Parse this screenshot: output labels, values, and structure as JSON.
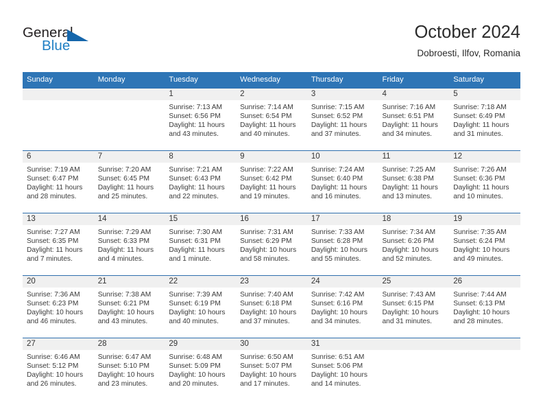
{
  "brand": {
    "name_part1": "General",
    "name_part2": "Blue",
    "logo_icon": "blue-triangle-icon"
  },
  "header": {
    "title": "October 2024",
    "subtitle": "Dobroesti, Ilfov, Romania"
  },
  "colors": {
    "header_blue": "#2e75b6",
    "separator_blue": "#2e6fae",
    "daynum_strip_gray": "#f0f0f0",
    "brand_blue": "#1f7fc4",
    "brand_dark": "#231f20",
    "text": "#333333"
  },
  "weekdays": [
    "Sunday",
    "Monday",
    "Tuesday",
    "Wednesday",
    "Thursday",
    "Friday",
    "Saturday"
  ],
  "labels": {
    "sunrise_prefix": "Sunrise: ",
    "sunset_prefix": "Sunset: ",
    "daylight_prefix": "Daylight: "
  },
  "weeks": [
    [
      {
        "day": "",
        "blank": true
      },
      {
        "day": "",
        "blank": true
      },
      {
        "day": "1",
        "sunrise": "Sunrise: 7:13 AM",
        "sunset": "Sunset: 6:56 PM",
        "daylight_1": "Daylight: 11 hours",
        "daylight_2": "and 43 minutes."
      },
      {
        "day": "2",
        "sunrise": "Sunrise: 7:14 AM",
        "sunset": "Sunset: 6:54 PM",
        "daylight_1": "Daylight: 11 hours",
        "daylight_2": "and 40 minutes."
      },
      {
        "day": "3",
        "sunrise": "Sunrise: 7:15 AM",
        "sunset": "Sunset: 6:52 PM",
        "daylight_1": "Daylight: 11 hours",
        "daylight_2": "and 37 minutes."
      },
      {
        "day": "4",
        "sunrise": "Sunrise: 7:16 AM",
        "sunset": "Sunset: 6:51 PM",
        "daylight_1": "Daylight: 11 hours",
        "daylight_2": "and 34 minutes."
      },
      {
        "day": "5",
        "sunrise": "Sunrise: 7:18 AM",
        "sunset": "Sunset: 6:49 PM",
        "daylight_1": "Daylight: 11 hours",
        "daylight_2": "and 31 minutes."
      }
    ],
    [
      {
        "day": "6",
        "sunrise": "Sunrise: 7:19 AM",
        "sunset": "Sunset: 6:47 PM",
        "daylight_1": "Daylight: 11 hours",
        "daylight_2": "and 28 minutes."
      },
      {
        "day": "7",
        "sunrise": "Sunrise: 7:20 AM",
        "sunset": "Sunset: 6:45 PM",
        "daylight_1": "Daylight: 11 hours",
        "daylight_2": "and 25 minutes."
      },
      {
        "day": "8",
        "sunrise": "Sunrise: 7:21 AM",
        "sunset": "Sunset: 6:43 PM",
        "daylight_1": "Daylight: 11 hours",
        "daylight_2": "and 22 minutes."
      },
      {
        "day": "9",
        "sunrise": "Sunrise: 7:22 AM",
        "sunset": "Sunset: 6:42 PM",
        "daylight_1": "Daylight: 11 hours",
        "daylight_2": "and 19 minutes."
      },
      {
        "day": "10",
        "sunrise": "Sunrise: 7:24 AM",
        "sunset": "Sunset: 6:40 PM",
        "daylight_1": "Daylight: 11 hours",
        "daylight_2": "and 16 minutes."
      },
      {
        "day": "11",
        "sunrise": "Sunrise: 7:25 AM",
        "sunset": "Sunset: 6:38 PM",
        "daylight_1": "Daylight: 11 hours",
        "daylight_2": "and 13 minutes."
      },
      {
        "day": "12",
        "sunrise": "Sunrise: 7:26 AM",
        "sunset": "Sunset: 6:36 PM",
        "daylight_1": "Daylight: 11 hours",
        "daylight_2": "and 10 minutes."
      }
    ],
    [
      {
        "day": "13",
        "sunrise": "Sunrise: 7:27 AM",
        "sunset": "Sunset: 6:35 PM",
        "daylight_1": "Daylight: 11 hours",
        "daylight_2": "and 7 minutes."
      },
      {
        "day": "14",
        "sunrise": "Sunrise: 7:29 AM",
        "sunset": "Sunset: 6:33 PM",
        "daylight_1": "Daylight: 11 hours",
        "daylight_2": "and 4 minutes."
      },
      {
        "day": "15",
        "sunrise": "Sunrise: 7:30 AM",
        "sunset": "Sunset: 6:31 PM",
        "daylight_1": "Daylight: 11 hours",
        "daylight_2": "and 1 minute."
      },
      {
        "day": "16",
        "sunrise": "Sunrise: 7:31 AM",
        "sunset": "Sunset: 6:29 PM",
        "daylight_1": "Daylight: 10 hours",
        "daylight_2": "and 58 minutes."
      },
      {
        "day": "17",
        "sunrise": "Sunrise: 7:33 AM",
        "sunset": "Sunset: 6:28 PM",
        "daylight_1": "Daylight: 10 hours",
        "daylight_2": "and 55 minutes."
      },
      {
        "day": "18",
        "sunrise": "Sunrise: 7:34 AM",
        "sunset": "Sunset: 6:26 PM",
        "daylight_1": "Daylight: 10 hours",
        "daylight_2": "and 52 minutes."
      },
      {
        "day": "19",
        "sunrise": "Sunrise: 7:35 AM",
        "sunset": "Sunset: 6:24 PM",
        "daylight_1": "Daylight: 10 hours",
        "daylight_2": "and 49 minutes."
      }
    ],
    [
      {
        "day": "20",
        "sunrise": "Sunrise: 7:36 AM",
        "sunset": "Sunset: 6:23 PM",
        "daylight_1": "Daylight: 10 hours",
        "daylight_2": "and 46 minutes."
      },
      {
        "day": "21",
        "sunrise": "Sunrise: 7:38 AM",
        "sunset": "Sunset: 6:21 PM",
        "daylight_1": "Daylight: 10 hours",
        "daylight_2": "and 43 minutes."
      },
      {
        "day": "22",
        "sunrise": "Sunrise: 7:39 AM",
        "sunset": "Sunset: 6:19 PM",
        "daylight_1": "Daylight: 10 hours",
        "daylight_2": "and 40 minutes."
      },
      {
        "day": "23",
        "sunrise": "Sunrise: 7:40 AM",
        "sunset": "Sunset: 6:18 PM",
        "daylight_1": "Daylight: 10 hours",
        "daylight_2": "and 37 minutes."
      },
      {
        "day": "24",
        "sunrise": "Sunrise: 7:42 AM",
        "sunset": "Sunset: 6:16 PM",
        "daylight_1": "Daylight: 10 hours",
        "daylight_2": "and 34 minutes."
      },
      {
        "day": "25",
        "sunrise": "Sunrise: 7:43 AM",
        "sunset": "Sunset: 6:15 PM",
        "daylight_1": "Daylight: 10 hours",
        "daylight_2": "and 31 minutes."
      },
      {
        "day": "26",
        "sunrise": "Sunrise: 7:44 AM",
        "sunset": "Sunset: 6:13 PM",
        "daylight_1": "Daylight: 10 hours",
        "daylight_2": "and 28 minutes."
      }
    ],
    [
      {
        "day": "27",
        "sunrise": "Sunrise: 6:46 AM",
        "sunset": "Sunset: 5:12 PM",
        "daylight_1": "Daylight: 10 hours",
        "daylight_2": "and 26 minutes."
      },
      {
        "day": "28",
        "sunrise": "Sunrise: 6:47 AM",
        "sunset": "Sunset: 5:10 PM",
        "daylight_1": "Daylight: 10 hours",
        "daylight_2": "and 23 minutes."
      },
      {
        "day": "29",
        "sunrise": "Sunrise: 6:48 AM",
        "sunset": "Sunset: 5:09 PM",
        "daylight_1": "Daylight: 10 hours",
        "daylight_2": "and 20 minutes."
      },
      {
        "day": "30",
        "sunrise": "Sunrise: 6:50 AM",
        "sunset": "Sunset: 5:07 PM",
        "daylight_1": "Daylight: 10 hours",
        "daylight_2": "and 17 minutes."
      },
      {
        "day": "31",
        "sunrise": "Sunrise: 6:51 AM",
        "sunset": "Sunset: 5:06 PM",
        "daylight_1": "Daylight: 10 hours",
        "daylight_2": "and 14 minutes."
      },
      {
        "day": "",
        "blank": true
      },
      {
        "day": "",
        "blank": true
      }
    ]
  ]
}
